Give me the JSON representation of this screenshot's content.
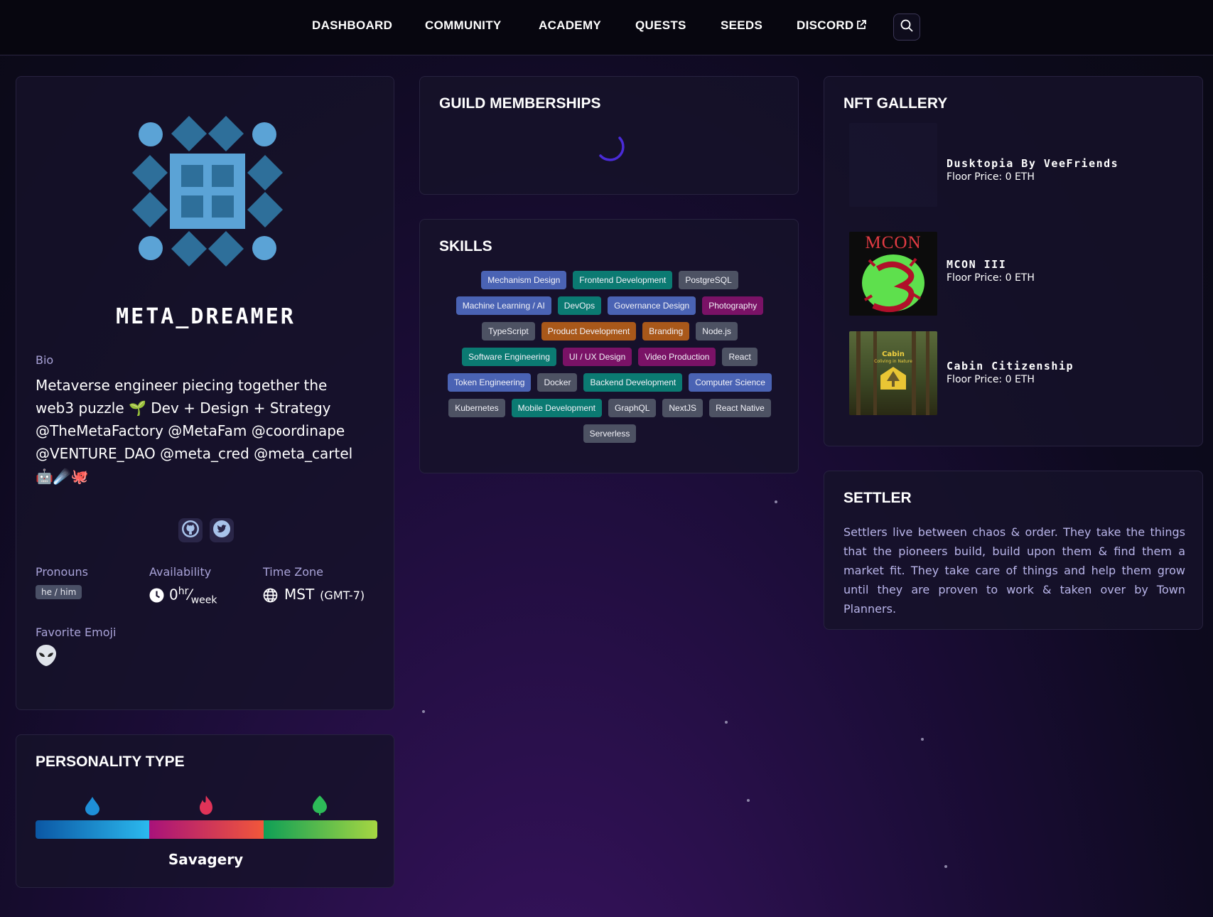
{
  "nav": {
    "items": [
      {
        "label": "DASHBOARD"
      },
      {
        "label": "COMMUNITY"
      },
      {
        "label": "ACADEMY"
      },
      {
        "label": "QUESTS"
      },
      {
        "label": "SEEDS"
      },
      {
        "label": "DISCORD"
      }
    ],
    "external_icon": "external-link-icon",
    "search_icon": "search-icon"
  },
  "profile": {
    "username": "META_DREAMER",
    "bio_label": "Bio",
    "bio": "Metaverse engineer piecing together the web3 puzzle 🌱 Dev + Design + Strategy @TheMetaFactory @MetaFam @coordinape @VENTURE_DAO @meta_cred @meta_cartel 🤖☄️🐙",
    "socials": [
      {
        "icon": "github-icon"
      },
      {
        "icon": "twitter-icon"
      }
    ],
    "pronouns_label": "Pronouns",
    "pronouns": "he / him",
    "availability_label": "Availability",
    "availability_value": "0",
    "availability_unit_top": "hr",
    "availability_unit_bottom": "week",
    "timezone_label": "Time Zone",
    "timezone": "MST",
    "timezone_offset": "(GMT-7)",
    "emoji_label": "Favorite Emoji",
    "emoji_icon": "alien-icon"
  },
  "personality": {
    "title": "PERSONALITY TYPE",
    "icons": [
      "water-drop-icon",
      "fire-icon",
      "leaf-icon"
    ],
    "type_name": "Savagery",
    "colors": [
      "#0b57a4",
      "#2bb9ee",
      "#a8127a",
      "#f1573a",
      "#0f9f56",
      "#a6d642"
    ]
  },
  "guilds": {
    "title": "GUILD MEMBERSHIPS"
  },
  "skills": {
    "title": "SKILLS",
    "items": [
      {
        "label": "Mechanism Design",
        "color": "blue"
      },
      {
        "label": "Frontend Development",
        "color": "teal"
      },
      {
        "label": "PostgreSQL",
        "color": "gray"
      },
      {
        "label": "Machine Learning / AI",
        "color": "blue"
      },
      {
        "label": "DevOps",
        "color": "teal"
      },
      {
        "label": "Governance Design",
        "color": "blue"
      },
      {
        "label": "Photography",
        "color": "purple"
      },
      {
        "label": "TypeScript",
        "color": "gray"
      },
      {
        "label": "Product Development",
        "color": "orange"
      },
      {
        "label": "Branding",
        "color": "orange"
      },
      {
        "label": "Node.js",
        "color": "gray"
      },
      {
        "label": "Software Engineering",
        "color": "teal"
      },
      {
        "label": "UI / UX Design",
        "color": "purple"
      },
      {
        "label": "Video Production",
        "color": "purple"
      },
      {
        "label": "React",
        "color": "gray"
      },
      {
        "label": "Token Engineering",
        "color": "blue"
      },
      {
        "label": "Docker",
        "color": "gray"
      },
      {
        "label": "Backend Development",
        "color": "teal"
      },
      {
        "label": "Computer Science",
        "color": "blue"
      },
      {
        "label": "Kubernetes",
        "color": "gray"
      },
      {
        "label": "Mobile Development",
        "color": "teal"
      },
      {
        "label": "GraphQL",
        "color": "gray"
      },
      {
        "label": "NextJS",
        "color": "gray"
      },
      {
        "label": "React Native",
        "color": "gray"
      },
      {
        "label": "Serverless",
        "color": "gray"
      }
    ]
  },
  "nft": {
    "title": "NFT GALLERY",
    "items": [
      {
        "name": "Dusktopia By VeeFriends",
        "price": "Floor Price: 0 ETH"
      },
      {
        "name": "MCON III",
        "price": "Floor Price: 0 ETH",
        "image_text": "MCON"
      },
      {
        "name": "Cabin Citizenship",
        "price": "Floor Price: 0 ETH",
        "image_text": "Cabin",
        "image_subtext": "Coliving in Nature"
      }
    ]
  },
  "settler": {
    "title": "SETTLER",
    "description": "Settlers live between chaos & order. They take the things that the pioneers build, build upon them & find them a market fit. They take care of things and help them grow until they are proven to work & taken over by Town Planners."
  }
}
